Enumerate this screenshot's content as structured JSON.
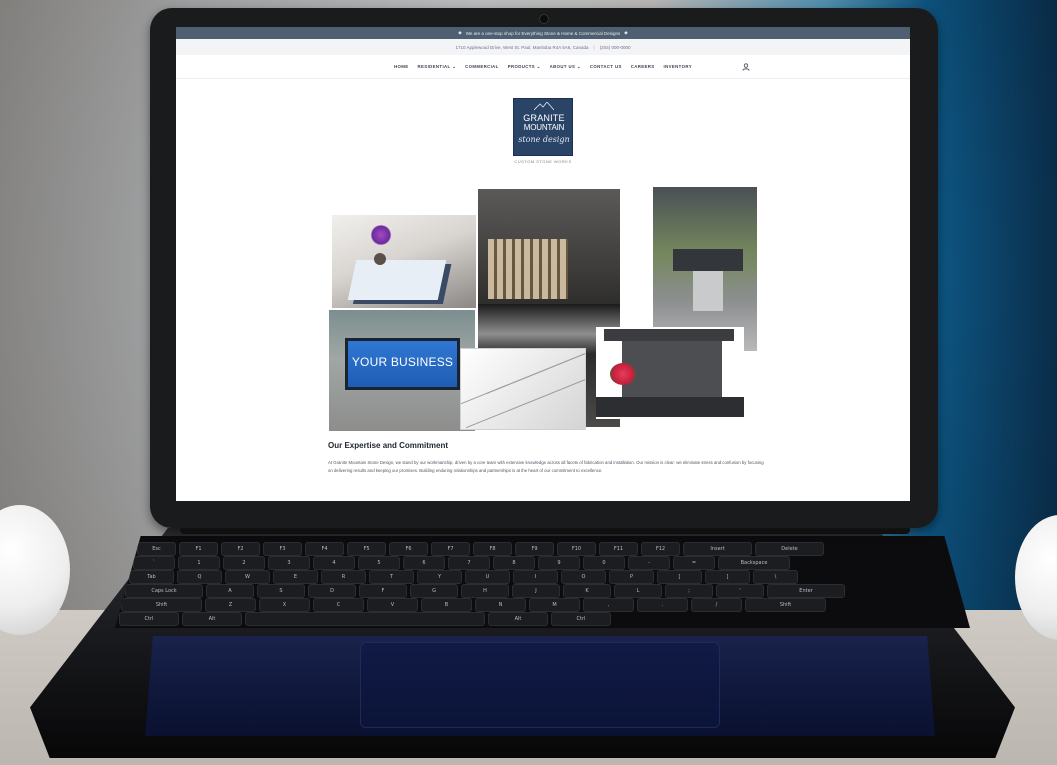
{
  "announcement": {
    "text": "We are a one-stop shop for Everything Stone & Home & Commercial Designs"
  },
  "address_bar": {
    "address": "1710 Applewood Drive, West St. Paul, Manitoba R4A 5A6, Canada",
    "phone": "(204) 000-0000"
  },
  "nav": {
    "items": [
      "HOME",
      "RESIDENTIAL ⌄",
      "COMMERCIAL",
      "PRODUCTS ⌄",
      "ABOUT US ⌄",
      "CONTACT US",
      "CAREERS",
      "INVENTORY"
    ]
  },
  "logo": {
    "line1": "GRANITE",
    "line2": "MOUNTAIN",
    "line3": "stone design",
    "tagline": "CUSTOM STONE WORKS"
  },
  "gallery": {
    "sign_text": "YOUR BUSINESS"
  },
  "content": {
    "heading": "Our Expertise and Commitment",
    "body": "At Granite Mountain Stone Design, we stand by our workmanship, driven by a core team with extensive knowledge across all facets of fabrication and installation. Our mission is clear: we eliminate stress and confusion by focusing on delivering results and keeping our promises. Building enduring relationships and partnerships is at the heart of our commitment to excellence."
  },
  "keyboard": {
    "fn_row": [
      "Esc",
      "F1",
      "F2",
      "F3",
      "F4",
      "F5",
      "F6",
      "F7",
      "F8",
      "F9",
      "F10",
      "F11",
      "F12",
      "Insert",
      "Delete"
    ],
    "row2": [
      "`",
      "1",
      "2",
      "3",
      "4",
      "5",
      "6",
      "7",
      "8",
      "9",
      "0",
      "-",
      "=",
      "Backspace"
    ],
    "row3": [
      "Tab",
      "Q",
      "W",
      "E",
      "R",
      "T",
      "Y",
      "U",
      "I",
      "O",
      "P",
      "[",
      "]",
      "\\"
    ],
    "row4": [
      "Caps Lock",
      "A",
      "S",
      "D",
      "F",
      "G",
      "H",
      "J",
      "K",
      "L",
      ";",
      "'",
      "Enter"
    ],
    "row5": [
      "Shift",
      "Z",
      "X",
      "C",
      "V",
      "B",
      "N",
      "M",
      ",",
      ".",
      "/",
      "Shift"
    ],
    "row6": [
      "Ctrl",
      "Alt",
      "",
      "Alt",
      "Ctrl"
    ]
  },
  "colors": {
    "announce_bar": "#4f5f72",
    "logo_bg": "#2a4468",
    "sign_blue": "#2f77d2"
  }
}
